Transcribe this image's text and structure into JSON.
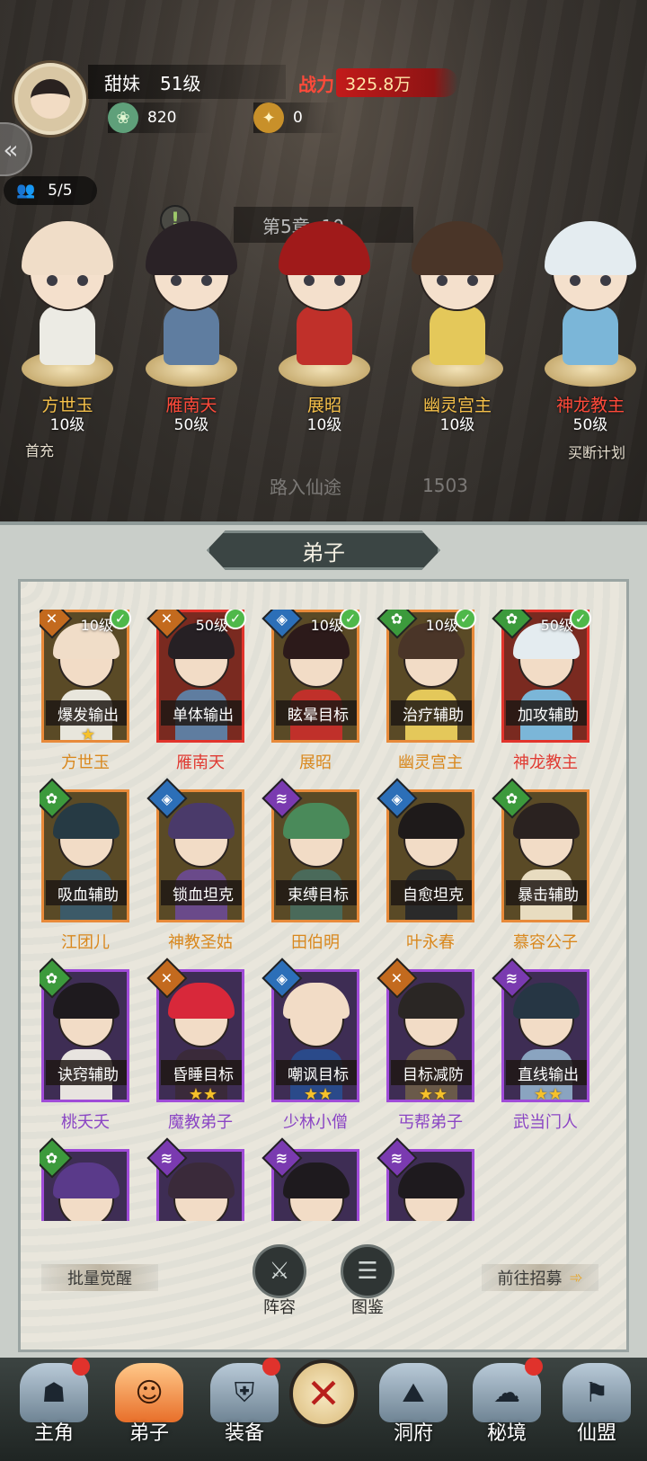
{
  "player": {
    "name": "甜妹",
    "level": "51级",
    "power_label": "战力",
    "power": "325.8万",
    "currency1": "820",
    "currency2": "0",
    "team": "5/5",
    "stage": "第5章 ·10"
  },
  "lineup": [
    {
      "name": "方世玉",
      "level": "10级",
      "color": "#f6c14a"
    },
    {
      "name": "雁南天",
      "level": "50级",
      "color": "#ff4a3a"
    },
    {
      "name": "展昭",
      "level": "10级",
      "color": "#f6c14a"
    },
    {
      "name": "幽灵宫主",
      "level": "10级",
      "color": "#f6c14a"
    },
    {
      "name": "神龙教主",
      "level": "50级",
      "color": "#ff4a3a"
    }
  ],
  "scene_labels": {
    "first_charge": "首充",
    "buy_plan": "买断计划",
    "hangup": "路入仙途",
    "hangup_count": "1503"
  },
  "panel": {
    "title": "弟子",
    "batch_awaken": "批量觉醒",
    "lineup_btn": "阵容",
    "codex_btn": "图鉴",
    "recruit": "前往招募"
  },
  "disciples": [
    {
      "name": "方世玉",
      "role": "爆发输出",
      "level": "10级",
      "stars": "★",
      "rarity": "orange",
      "cls": "atk",
      "cls_glyph": "✕",
      "check": true,
      "hair": "#f0ddc8",
      "robe": "#e8e6dc"
    },
    {
      "name": "雁南天",
      "role": "单体输出",
      "level": "50级",
      "stars": "",
      "rarity": "red",
      "cls": "atk",
      "cls_glyph": "✕",
      "check": true,
      "hair": "#262024",
      "robe": "#5f7da0"
    },
    {
      "name": "展昭",
      "role": "眩晕目标",
      "level": "10级",
      "stars": "",
      "rarity": "orange",
      "cls": "def",
      "cls_glyph": "◈",
      "check": true,
      "hair": "#2c1a1a",
      "robe": "#c0302a"
    },
    {
      "name": "幽灵宫主",
      "role": "治疗辅助",
      "level": "10级",
      "stars": "",
      "rarity": "orange",
      "cls": "sup",
      "cls_glyph": "✿",
      "check": true,
      "hair": "#4a3528",
      "robe": "#e4c85a"
    },
    {
      "name": "神龙教主",
      "role": "加攻辅助",
      "level": "50级",
      "stars": "",
      "rarity": "red",
      "cls": "sup",
      "cls_glyph": "✿",
      "check": true,
      "hair": "#e4ecf0",
      "robe": "#7bb6d8"
    },
    {
      "name": "江团儿",
      "role": "吸血辅助",
      "level": "",
      "stars": "",
      "rarity": "orange",
      "cls": "sup",
      "cls_glyph": "✿",
      "check": false,
      "hair": "#263a44",
      "robe": "#3c5a68"
    },
    {
      "name": "神教圣姑",
      "role": "锁血坦克",
      "level": "",
      "stars": "",
      "rarity": "orange",
      "cls": "def",
      "cls_glyph": "◈",
      "check": false,
      "hair": "#4a3a6a",
      "robe": "#6a4a8a"
    },
    {
      "name": "田伯明",
      "role": "束缚目标",
      "level": "",
      "stars": "",
      "rarity": "orange",
      "cls": "ctl",
      "cls_glyph": "≋",
      "check": false,
      "hair": "#4a8a5a",
      "robe": "#4a6a5a"
    },
    {
      "name": "叶永春",
      "role": "自愈坦克",
      "level": "",
      "stars": "",
      "rarity": "orange",
      "cls": "def",
      "cls_glyph": "◈",
      "check": false,
      "hair": "#1e1a1a",
      "robe": "#2a2a2a"
    },
    {
      "name": "慕容公子",
      "role": "暴击辅助",
      "level": "",
      "stars": "",
      "rarity": "orange",
      "cls": "sup",
      "cls_glyph": "✿",
      "check": false,
      "hair": "#2a2220",
      "robe": "#e8dcc0"
    },
    {
      "name": "桃夭夭",
      "role": "诀窍辅助",
      "level": "",
      "stars": "",
      "rarity": "purple",
      "cls": "sup",
      "cls_glyph": "✿",
      "check": false,
      "hair": "#1e1a1e",
      "robe": "#e8e4e0"
    },
    {
      "name": "魔教弟子",
      "role": "昏睡目标",
      "level": "",
      "stars": "★★",
      "rarity": "purple",
      "cls": "atk",
      "cls_glyph": "✕",
      "check": false,
      "hair": "#d8283a",
      "robe": "#3a2a3a"
    },
    {
      "name": "少林小僧",
      "role": "嘲讽目标",
      "level": "",
      "stars": "★★",
      "rarity": "purple",
      "cls": "def",
      "cls_glyph": "◈",
      "check": false,
      "hair": "#f2dcc6",
      "robe": "#2a4a8a"
    },
    {
      "name": "丐帮弟子",
      "role": "目标减防",
      "level": "",
      "stars": "★★",
      "rarity": "purple",
      "cls": "atk",
      "cls_glyph": "✕",
      "check": false,
      "hair": "#2a2624",
      "robe": "#6a5a4a"
    },
    {
      "name": "武当门人",
      "role": "直线输出",
      "level": "",
      "stars": "★★",
      "rarity": "purple",
      "cls": "ctl",
      "cls_glyph": "≋",
      "check": false,
      "hair": "#263644",
      "robe": "#8aa4c0"
    },
    {
      "name": "",
      "role": "",
      "level": "",
      "stars": "",
      "rarity": "purple",
      "cls": "sup",
      "cls_glyph": "✿",
      "check": false,
      "hair": "#5a3a8a",
      "robe": "#7a5aa0"
    },
    {
      "name": "",
      "role": "",
      "level": "",
      "stars": "",
      "rarity": "purple",
      "cls": "ctl",
      "cls_glyph": "≋",
      "check": false,
      "hair": "#3a2a3a",
      "robe": "#5a3a5a"
    },
    {
      "name": "",
      "role": "",
      "level": "",
      "stars": "",
      "rarity": "purple",
      "cls": "ctl",
      "cls_glyph": "≋",
      "check": false,
      "hair": "#1e1a1e",
      "robe": "#8a2a2a"
    },
    {
      "name": "",
      "role": "",
      "level": "",
      "stars": "",
      "rarity": "purple",
      "cls": "ctl",
      "cls_glyph": "≋",
      "check": false,
      "hair": "#1e1a1e",
      "robe": "#3a5a4a"
    }
  ],
  "nav": [
    {
      "label": "主角",
      "icon": "hero-icon",
      "glyph": "☗",
      "dot": true,
      "active": false
    },
    {
      "label": "弟子",
      "icon": "disciple-icon",
      "glyph": "☺",
      "dot": false,
      "active": true
    },
    {
      "label": "装备",
      "icon": "equipment-icon",
      "glyph": "⛨",
      "dot": true,
      "active": false
    },
    {
      "label": "洞府",
      "icon": "cave-icon",
      "glyph": "⛰",
      "dot": false,
      "active": false
    },
    {
      "label": "秘境",
      "icon": "realm-icon",
      "glyph": "☁",
      "dot": true,
      "active": false
    },
    {
      "label": "仙盟",
      "icon": "alliance-icon",
      "glyph": "⚑",
      "dot": false,
      "active": false
    }
  ]
}
